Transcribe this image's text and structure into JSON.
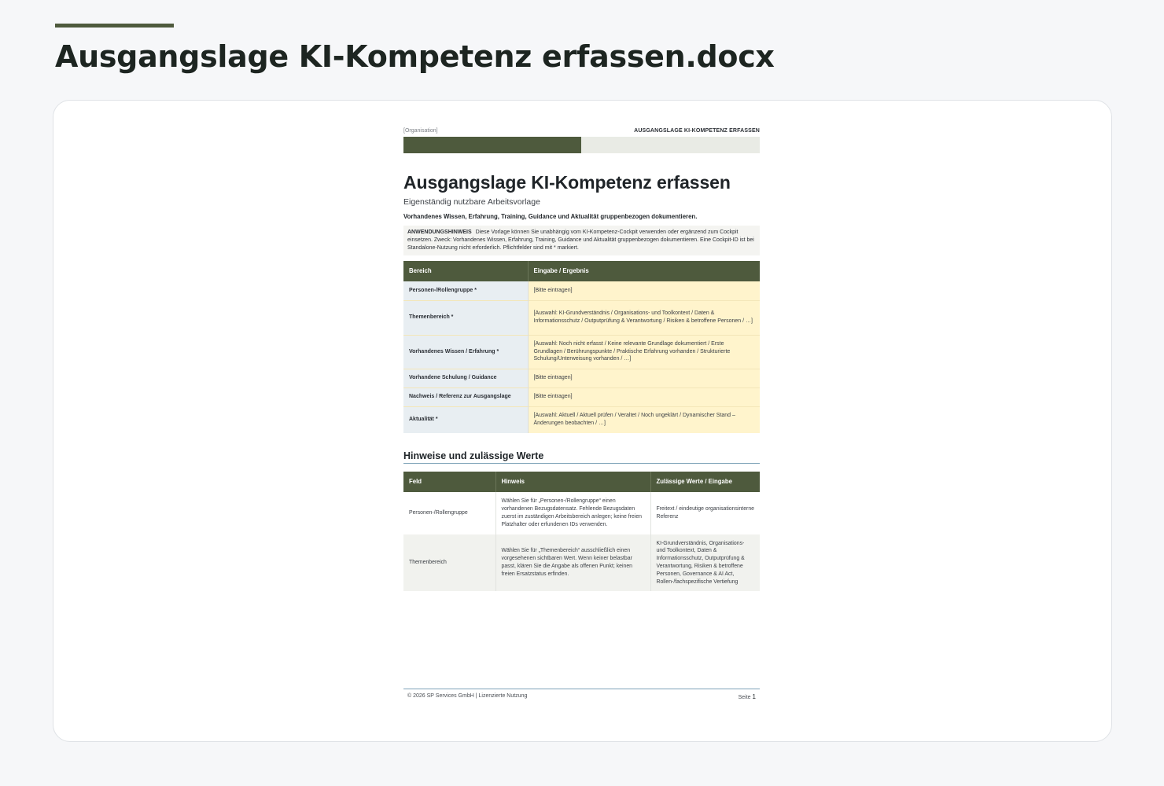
{
  "page": {
    "title": "Ausgangslage KI-Kompetenz erfassen.docx"
  },
  "document": {
    "header": {
      "organization": "[Organisation]",
      "title": "AUSGANGSLAGE KI-KOMPETENZ ERFASSEN"
    },
    "title": "Ausgangslage KI-Kompetenz erfassen",
    "subtitle": "Eigenständig nutzbare Arbeitsvorlage",
    "lead": "Vorhandenes Wissen, Erfahrung, Training, Guidance und Aktualität gruppenbezogen dokumentieren.",
    "hint": {
      "label": "ANWENDUNGSHINWEIS",
      "text": "Diese Vorlage können Sie unabhängig vom KI-Kompetenz-Cockpit verwenden oder ergänzend zum Cockpit einsetzen. Zweck: Vorhandenes Wissen, Erfahrung, Training, Guidance und Aktualität gruppenbezogen dokumentieren. Eine Cockpit-ID ist bei Standalone-Nutzung nicht erforderlich. Pflichtfelder sind mit * markiert."
    },
    "form_table": {
      "headers": [
        "Bereich",
        "Eingabe / Ergebnis"
      ],
      "rows": [
        {
          "label": "Personen-/Rollengruppe *",
          "value": "[Bitte eintragen]"
        },
        {
          "label": "Themenbereich *",
          "value": "[Auswahl: KI-Grundverständnis / Organisations- und Toolkontext / Daten & Informationsschutz / Outputprüfung & Verantwortung / Risiken & betroffene Personen / …]"
        },
        {
          "label": "Vorhandenes Wissen / Erfahrung *",
          "value": "[Auswahl: Noch nicht erfasst / Keine relevante Grundlage dokumentiert / Erste Grundlagen / Berührungspunkte / Praktische Erfahrung vorhanden / Strukturierte Schulung/Unterweisung vorhanden / …]"
        },
        {
          "label": "Vorhandene Schulung / Guidance",
          "value": "[Bitte eintragen]"
        },
        {
          "label": "Nachweis / Referenz zur Ausgangslage",
          "value": "[Bitte eintragen]"
        },
        {
          "label": "Aktualität *",
          "value": "[Auswahl: Aktuell / Aktuell prüfen / Veraltet / Noch ungeklärt / Dynamischer Stand – Änderungen beobachten / …]"
        }
      ]
    },
    "notes_section": {
      "title": "Hinweise und zulässige Werte",
      "headers": [
        "Feld",
        "Hinweis",
        "Zulässige Werte / Eingabe"
      ],
      "rows": [
        {
          "field": "Personen-/Rollengruppe",
          "hint": "Wählen Sie für „Personen-/Rollengruppe“ einen vorhandenen Bezugsdatensatz. Fehlende Bezugsdaten zuerst im zuständigen Arbeitsbereich anlegen; keine freien Platzhalter oder erfundenen IDs verwenden.",
          "allowed": "Freitext / eindeutige organisationsinterne Referenz"
        },
        {
          "field": "Themenbereich",
          "hint": "Wählen Sie für „Themenbereich“ ausschließlich einen vorgesehenen sichtbaren Wert. Wenn keiner belastbar passt, klären Sie die Angabe als offenen Punkt; keinen freien Ersatzstatus erfinden.",
          "allowed": "KI-Grundverständnis, Organisations- und Toolkontext, Daten & Informationsschutz, Outputprüfung & Verantwortung, Risiken & betroffene Personen, Governance & AI Act, Rollen-/fachspezifische Vertiefung"
        }
      ]
    },
    "footer": {
      "copyright": "© 2026 SP Services GmbH | Lizenzierte Nutzung",
      "page_label": "Seite",
      "page_number": "1"
    }
  },
  "colors": {
    "accent": "#4e5a3d",
    "label_cell": "#e8eef2",
    "input_cell": "#fff4cc",
    "rule": "#7ea3b8"
  }
}
